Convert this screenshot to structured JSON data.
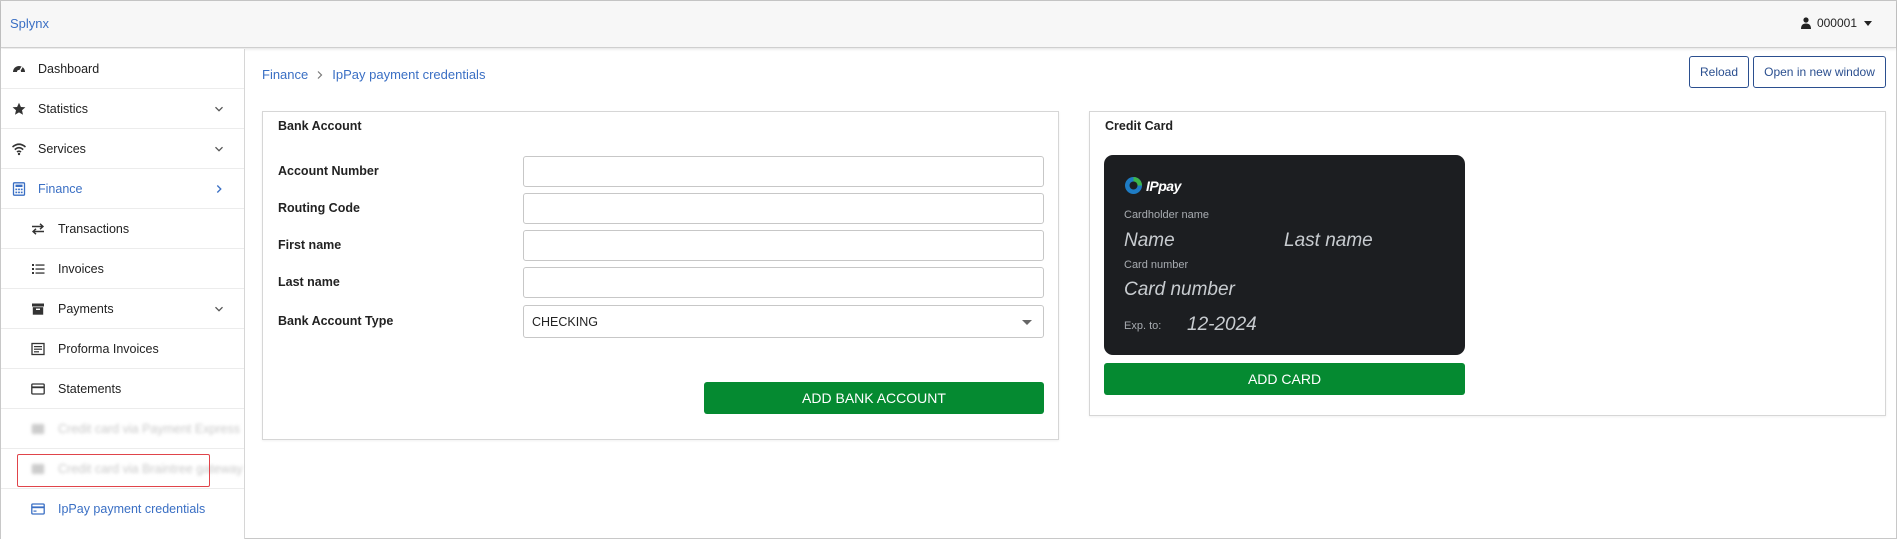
{
  "topbar": {
    "brand": "Splynx",
    "user": "000001"
  },
  "sidebar": {
    "items": [
      {
        "label": "Dashboard",
        "icon": "dashboard-icon"
      },
      {
        "label": "Statistics",
        "icon": "star-icon"
      },
      {
        "label": "Services",
        "icon": "wifi-icon"
      },
      {
        "label": "Finance",
        "icon": "calculator-icon"
      },
      {
        "label": "Transactions",
        "icon": "exchange-icon"
      },
      {
        "label": "Invoices",
        "icon": "list-icon"
      },
      {
        "label": "Payments",
        "icon": "archive-icon"
      },
      {
        "label": "Proforma Invoices",
        "icon": "document-icon"
      },
      {
        "label": "Statements",
        "icon": "card-icon"
      },
      {
        "label": "Credit card via Payment Express",
        "icon": "card-icon"
      },
      {
        "label": "Credit card via Braintree gateway",
        "icon": "card-icon"
      },
      {
        "label": "IpPay payment credentials",
        "icon": "credit-card-icon"
      }
    ]
  },
  "breadcrumb": {
    "root": "Finance",
    "current": "IpPay payment credentials"
  },
  "toolbar": {
    "reload": "Reload",
    "open_new_window": "Open in new window"
  },
  "bank_account": {
    "title": "Bank Account",
    "fields": {
      "account_number": {
        "label": "Account Number",
        "value": ""
      },
      "routing_code": {
        "label": "Routing Code",
        "value": ""
      },
      "first_name": {
        "label": "First name",
        "value": ""
      },
      "last_name": {
        "label": "Last name",
        "value": ""
      },
      "account_type": {
        "label": "Bank Account Type",
        "value": "CHECKING"
      }
    },
    "submit": "ADD BANK ACCOUNT"
  },
  "credit_card": {
    "title": "Credit Card",
    "card": {
      "logo": "IPpay",
      "cardholder_label": "Cardholder name",
      "first_name": "Name",
      "last_name": "Last name",
      "number_label": "Card number",
      "number": "Card number",
      "exp_label": "Exp. to:",
      "exp": "12-2024"
    },
    "submit": "ADD CARD"
  },
  "colors": {
    "accent": "#3a6fc4",
    "green": "#058a31",
    "highlight": "#e0444a"
  }
}
